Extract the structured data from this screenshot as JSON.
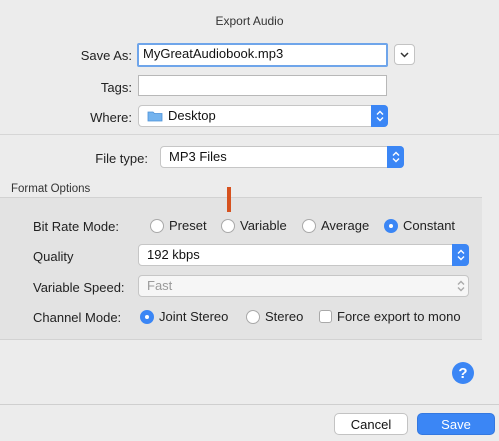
{
  "dialog": {
    "title": "Export Audio"
  },
  "save_as": {
    "label": "Save As:",
    "value": "MyGreatAudiobook.mp3"
  },
  "tags": {
    "label": "Tags:",
    "value": ""
  },
  "where": {
    "label": "Where:",
    "value": "Desktop",
    "icon": "folder-icon"
  },
  "file_type": {
    "label": "File type:",
    "value": "MP3 Files"
  },
  "format_options": {
    "title": "Format Options",
    "bit_rate_mode": {
      "label": "Bit Rate Mode:",
      "options": [
        "Preset",
        "Variable",
        "Average",
        "Constant"
      ],
      "selected": "Constant"
    },
    "quality": {
      "label": "Quality",
      "value": "192 kbps"
    },
    "variable_speed": {
      "label": "Variable Speed:",
      "value": "Fast",
      "disabled": true
    },
    "channel_mode": {
      "label": "Channel Mode:",
      "options": [
        "Joint Stereo",
        "Stereo"
      ],
      "selected": "Joint Stereo",
      "force_mono_label": "Force export to mono",
      "force_mono_checked": false
    }
  },
  "help": {
    "glyph": "?"
  },
  "buttons": {
    "cancel": "Cancel",
    "save": "Save"
  },
  "colors": {
    "accent": "#3b86f5",
    "marker": "#d6521f"
  }
}
